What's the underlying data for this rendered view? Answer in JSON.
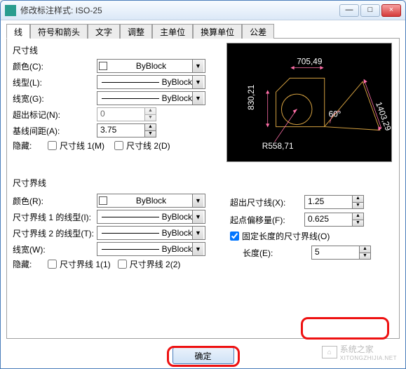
{
  "window": {
    "title": "修改标注样式: ISO-25",
    "min": "—",
    "max": "□",
    "close": "×"
  },
  "tabs": [
    "线",
    "符号和箭头",
    "文字",
    "调整",
    "主单位",
    "换算单位",
    "公差"
  ],
  "dimlines": {
    "group": "尺寸线",
    "color_lbl": "颜色(C):",
    "color_val": "ByBlock",
    "linetype_lbl": "线型(L):",
    "linetype_val": "ByBlock",
    "lineweight_lbl": "线宽(G):",
    "lineweight_val": "ByBlock",
    "extend_lbl": "超出标记(N):",
    "extend_val": "0",
    "baseline_lbl": "基线间距(A):",
    "baseline_val": "3.75",
    "hide_lbl": "隐藏:",
    "hide1": "尺寸线 1(M)",
    "hide2": "尺寸线 2(D)"
  },
  "extlines": {
    "group": "尺寸界线",
    "color_lbl": "颜色(R):",
    "color_val": "ByBlock",
    "lt1_lbl": "尺寸界线 1 的线型(I):",
    "lt1_val": "ByBlock",
    "lt2_lbl": "尺寸界线 2 的线型(T):",
    "lt2_val": "ByBlock",
    "lineweight_lbl": "线宽(W):",
    "lineweight_val": "ByBlock",
    "hide_lbl": "隐藏:",
    "hide1": "尺寸界线 1(1)",
    "hide2": "尺寸界线 2(2)",
    "beyond_lbl": "超出尺寸线(X):",
    "beyond_val": "1.25",
    "offset_lbl": "起点偏移量(F):",
    "offset_val": "0.625",
    "fixed_chk": "固定长度的尺寸界线(O)",
    "length_lbl": "长度(E):",
    "length_val": "5"
  },
  "preview": {
    "d1": "705,49",
    "d2": "830,21",
    "d3": "1403,29",
    "d4": "R558,71",
    "angle": "60°"
  },
  "buttons": {
    "ok": "确定"
  },
  "watermark": {
    "text": "系统之家",
    "url": "XITONGZHIJIA.NET"
  }
}
